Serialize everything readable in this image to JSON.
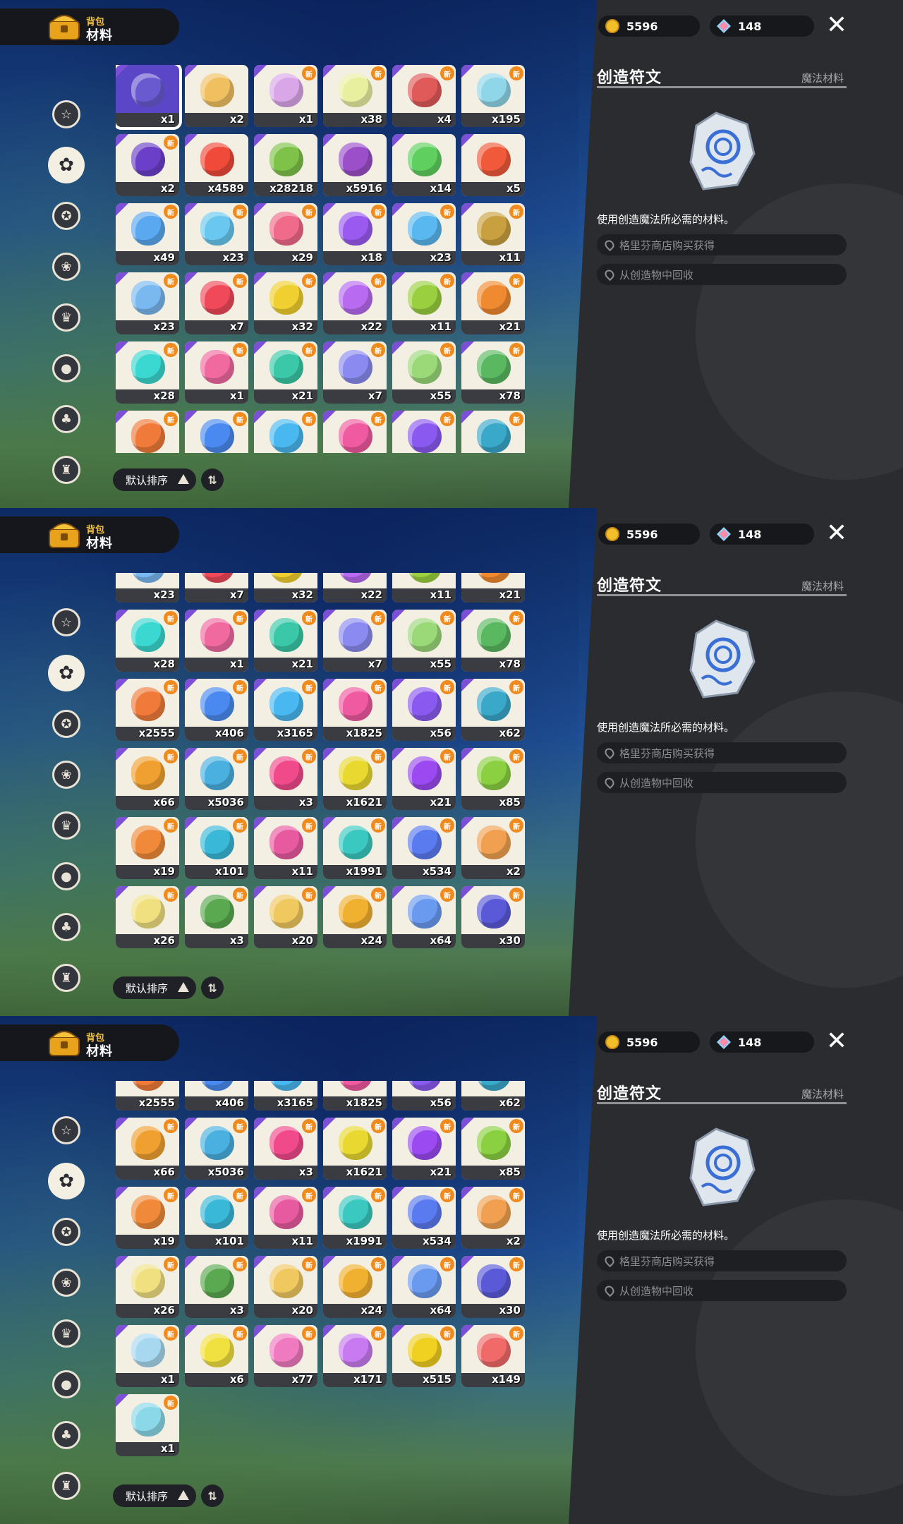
{
  "header": {
    "category_small": "背包",
    "category_big": "材料"
  },
  "currency": {
    "gold": "5596",
    "gems": "148"
  },
  "detail": {
    "title": "创造符文",
    "type": "魔法材料",
    "description": "使用创造魔法所必需的材料。",
    "sources": [
      "格里芬商店购买获得",
      "从创造物中回收"
    ]
  },
  "sort": {
    "label": "默认排序"
  },
  "icons": {
    "sidebar": [
      "star-icon",
      "leaf-icon",
      "gear-star-icon",
      "sprout-icon",
      "scroll-icon",
      "ball-icon",
      "acorn-icon",
      "crown-icon"
    ],
    "close": "close-icon",
    "sort_toggle": "sort-toggle-icon"
  },
  "panels": [
    {
      "rows": [
        [
          {
            "c": "x1",
            "col": "#6a5ad0",
            "sel": true
          },
          {
            "c": "x2",
            "col": "#f0c060"
          },
          {
            "c": "x1",
            "col": "#d9a7e8",
            "n": true
          },
          {
            "c": "x38",
            "col": "#e8f0a0",
            "n": true
          },
          {
            "c": "x4",
            "col": "#e05a5a",
            "n": true
          },
          {
            "c": "x195",
            "col": "#8fd6e8",
            "n": true
          }
        ],
        [
          {
            "c": "x2",
            "col": "#6b3fc7",
            "n": true
          },
          {
            "c": "x4589",
            "col": "#f04a3a"
          },
          {
            "c": "x28218",
            "col": "#7fc24a"
          },
          {
            "c": "x5916",
            "col": "#9b4fc9"
          },
          {
            "c": "x14",
            "col": "#5fd05f"
          },
          {
            "c": "x5",
            "col": "#f05a3a"
          }
        ],
        [
          {
            "c": "x49",
            "col": "#5aa8f0",
            "n": true
          },
          {
            "c": "x23",
            "col": "#6ac8f0",
            "n": true
          },
          {
            "c": "x29",
            "col": "#f06a8a",
            "n": true
          },
          {
            "c": "x18",
            "col": "#9a5af0",
            "n": true
          },
          {
            "c": "x23",
            "col": "#5ab8f0",
            "n": true
          },
          {
            "c": "x11",
            "col": "#c8a040",
            "n": true
          }
        ],
        [
          {
            "c": "x23",
            "col": "#7ab8f0",
            "n": true
          },
          {
            "c": "x7",
            "col": "#f04a5a",
            "n": true
          },
          {
            "c": "x32",
            "col": "#f0d030",
            "n": true
          },
          {
            "c": "x22",
            "col": "#b86af0",
            "n": true
          },
          {
            "c": "x11",
            "col": "#9ad040",
            "n": true
          },
          {
            "c": "x21",
            "col": "#f08a30",
            "n": true
          }
        ],
        [
          {
            "c": "x28",
            "col": "#3ad8d0",
            "n": true
          },
          {
            "c": "x1",
            "col": "#f06aa0",
            "n": true
          },
          {
            "c": "x21",
            "col": "#3ac8a8",
            "n": true
          },
          {
            "c": "x7",
            "col": "#8a8af0",
            "n": true
          },
          {
            "c": "x55",
            "col": "#9ad878",
            "n": true
          },
          {
            "c": "x78",
            "col": "#5ab860",
            "n": true
          }
        ],
        [
          {
            "c": "",
            "col": "#f07a3a",
            "n": true
          },
          {
            "c": "",
            "col": "#4a8af0",
            "n": true
          },
          {
            "c": "",
            "col": "#4ab8f0",
            "n": true
          },
          {
            "c": "",
            "col": "#f05aa0",
            "n": true
          },
          {
            "c": "",
            "col": "#8a5af0",
            "n": true
          },
          {
            "c": "",
            "col": "#3aa8c8",
            "n": true
          }
        ]
      ]
    },
    {
      "rows": [
        [
          {
            "c": "x23",
            "col": "#7ab8f0"
          },
          {
            "c": "x7",
            "col": "#f04a5a"
          },
          {
            "c": "x32",
            "col": "#f0d030"
          },
          {
            "c": "x22",
            "col": "#b86af0"
          },
          {
            "c": "x11",
            "col": "#9ad040"
          },
          {
            "c": "x21",
            "col": "#f08a30"
          }
        ],
        [
          {
            "c": "x28",
            "col": "#3ad8d0",
            "n": true
          },
          {
            "c": "x1",
            "col": "#f06aa0",
            "n": true
          },
          {
            "c": "x21",
            "col": "#3ac8a8",
            "n": true
          },
          {
            "c": "x7",
            "col": "#8a8af0",
            "n": true
          },
          {
            "c": "x55",
            "col": "#9ad878",
            "n": true
          },
          {
            "c": "x78",
            "col": "#5ab860",
            "n": true
          }
        ],
        [
          {
            "c": "x2555",
            "col": "#f07a3a",
            "n": true
          },
          {
            "c": "x406",
            "col": "#4a8af0",
            "n": true
          },
          {
            "c": "x3165",
            "col": "#4ab8f0",
            "n": true
          },
          {
            "c": "x1825",
            "col": "#f05aa0",
            "n": true
          },
          {
            "c": "x56",
            "col": "#8a5af0",
            "n": true
          },
          {
            "c": "x62",
            "col": "#3aa8c8",
            "n": true
          }
        ],
        [
          {
            "c": "x66",
            "col": "#f0a030",
            "n": true
          },
          {
            "c": "x5036",
            "col": "#4ab0e0",
            "n": true
          },
          {
            "c": "x3",
            "col": "#f04a8a",
            "n": true
          },
          {
            "c": "x1621",
            "col": "#e8d830",
            "n": true
          },
          {
            "c": "x21",
            "col": "#9a4af0",
            "n": true
          },
          {
            "c": "x85",
            "col": "#8ad040",
            "n": true
          }
        ],
        [
          {
            "c": "x19",
            "col": "#f08a3a",
            "n": true
          },
          {
            "c": "x101",
            "col": "#3ab8d8",
            "n": true
          },
          {
            "c": "x11",
            "col": "#e85aa0",
            "n": true
          },
          {
            "c": "x1991",
            "col": "#3ac8c0",
            "n": true
          },
          {
            "c": "x534",
            "col": "#5a7af0",
            "n": true
          },
          {
            "c": "x2",
            "col": "#f0a050",
            "n": true
          }
        ],
        [
          {
            "c": "x26",
            "col": "#f0e080",
            "n": true
          },
          {
            "c": "x3",
            "col": "#5aa850",
            "n": true
          },
          {
            "c": "x20",
            "col": "#f0c860",
            "n": true
          },
          {
            "c": "x24",
            "col": "#f0b030",
            "n": true
          },
          {
            "c": "x64",
            "col": "#6a9af0",
            "n": true
          },
          {
            "c": "x30",
            "col": "#5a5ad8",
            "n": true
          }
        ]
      ]
    },
    {
      "rows": [
        [
          {
            "c": "x2555",
            "col": "#f07a3a"
          },
          {
            "c": "x406",
            "col": "#4a8af0"
          },
          {
            "c": "x3165",
            "col": "#4ab8f0"
          },
          {
            "c": "x1825",
            "col": "#f05aa0"
          },
          {
            "c": "x56",
            "col": "#8a5af0"
          },
          {
            "c": "x62",
            "col": "#3aa8c8"
          }
        ],
        [
          {
            "c": "x66",
            "col": "#f0a030",
            "n": true
          },
          {
            "c": "x5036",
            "col": "#4ab0e0",
            "n": true
          },
          {
            "c": "x3",
            "col": "#f04a8a",
            "n": true
          },
          {
            "c": "x1621",
            "col": "#e8d830",
            "n": true
          },
          {
            "c": "x21",
            "col": "#9a4af0",
            "n": true
          },
          {
            "c": "x85",
            "col": "#8ad040",
            "n": true
          }
        ],
        [
          {
            "c": "x19",
            "col": "#f08a3a",
            "n": true
          },
          {
            "c": "x101",
            "col": "#3ab8d8",
            "n": true
          },
          {
            "c": "x11",
            "col": "#e85aa0",
            "n": true
          },
          {
            "c": "x1991",
            "col": "#3ac8c0",
            "n": true
          },
          {
            "c": "x534",
            "col": "#5a7af0",
            "n": true
          },
          {
            "c": "x2",
            "col": "#f0a050",
            "n": true
          }
        ],
        [
          {
            "c": "x26",
            "col": "#f0e080",
            "n": true
          },
          {
            "c": "x3",
            "col": "#5aa850",
            "n": true
          },
          {
            "c": "x20",
            "col": "#f0c860",
            "n": true
          },
          {
            "c": "x24",
            "col": "#f0b030",
            "n": true
          },
          {
            "c": "x64",
            "col": "#6a9af0",
            "n": true
          },
          {
            "c": "x30",
            "col": "#5a5ad8",
            "n": true
          }
        ],
        [
          {
            "c": "x1",
            "col": "#a8d8f0",
            "n": true
          },
          {
            "c": "x6",
            "col": "#f0e040",
            "n": true
          },
          {
            "c": "x77",
            "col": "#f07ac0",
            "n": true
          },
          {
            "c": "x171",
            "col": "#c87af0",
            "n": true
          },
          {
            "c": "x515",
            "col": "#f0d020",
            "n": true
          },
          {
            "c": "x149",
            "col": "#f06a6a",
            "n": true
          }
        ],
        [
          {
            "c": "x1",
            "col": "#8ad8e8",
            "n": true
          }
        ]
      ]
    }
  ]
}
